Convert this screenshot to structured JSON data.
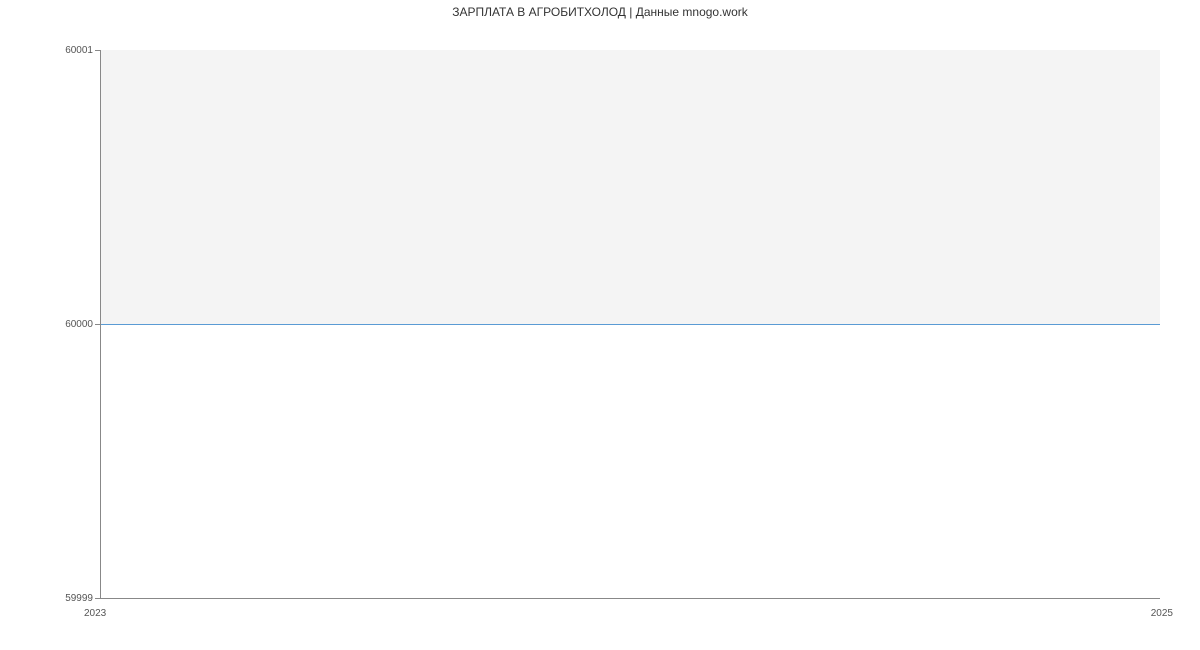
{
  "chart_data": {
    "type": "area",
    "title": "ЗАРПЛАТА В АГРОБИТХОЛОД | Данные mnogo.work",
    "xlabel": "",
    "ylabel": "",
    "x": [
      2023,
      2025
    ],
    "values": [
      60000,
      60000
    ],
    "ylim": [
      59999,
      60001
    ],
    "xlim": [
      2023,
      2025
    ],
    "y_ticks": [
      59999,
      60000,
      60001
    ],
    "x_ticks": [
      2023,
      2025
    ],
    "fill_color": "#f4f4f4",
    "line_color": "#5a9bd4"
  }
}
